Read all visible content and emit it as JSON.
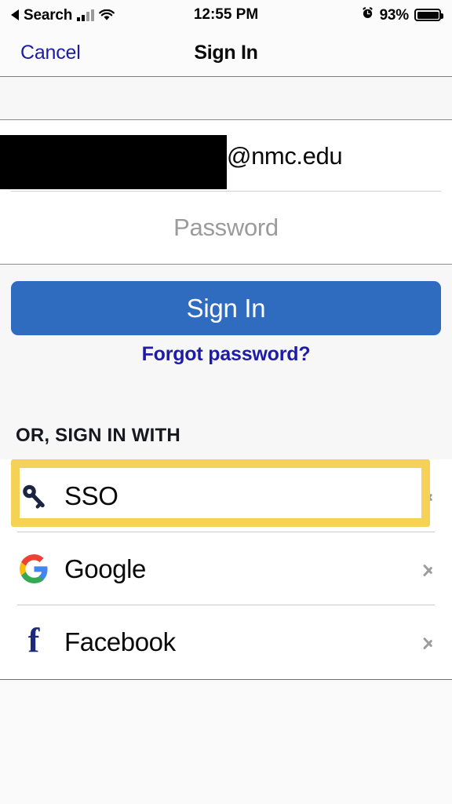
{
  "status_bar": {
    "back_label": "Search",
    "back_icon": "back-triangle-icon",
    "signal_icon": "cellular-signal-icon",
    "wifi_icon": "wifi-icon",
    "time": "12:55 PM",
    "alarm_icon": "alarm-clock-icon",
    "battery_percent": "93%",
    "battery_icon": "battery-full-icon"
  },
  "nav_bar": {
    "cancel_label": "Cancel",
    "title": "Sign In"
  },
  "form": {
    "email_value": "@nmc.edu",
    "email_redacted": true,
    "password_placeholder": "Password"
  },
  "actions": {
    "signin_label": "Sign In",
    "forgot_label": "Forgot password?"
  },
  "sso_section": {
    "header": "OR, SIGN IN WITH",
    "providers": [
      {
        "label": "SSO",
        "icon": "key-icon",
        "chevron": "chevron-right-icon",
        "highlighted": true
      },
      {
        "label": "Google",
        "icon": "google-logo-icon",
        "chevron": "chevron-right-icon",
        "highlighted": false
      },
      {
        "label": "Facebook",
        "icon": "facebook-logo-icon",
        "chevron": "chevron-right-icon",
        "highlighted": false
      }
    ]
  },
  "colors": {
    "primary_button": "#2f6cbf",
    "link": "#1c1ca8",
    "highlight_annotation": "#f5d155",
    "placeholder": "#9b9b9b",
    "page_background": "#f7f7f7",
    "facebook_blue": "#1b2a78",
    "key_navy": "#1c2540"
  }
}
